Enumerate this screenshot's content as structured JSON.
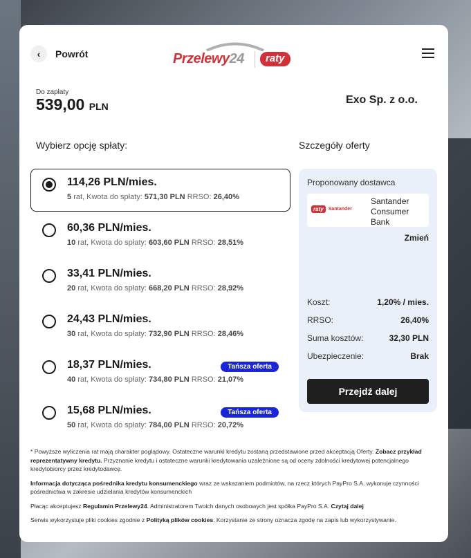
{
  "header": {
    "back_label": "Powrót",
    "logo_text": "Przelewy",
    "logo_num": "24",
    "logo_raty": "raty"
  },
  "summary": {
    "amount_label": "Do zapłaty",
    "amount_value": "539,00",
    "currency": "PLN",
    "merchant": "Exo Sp. z o.o."
  },
  "options_title": "Wybierz opcję spłaty:",
  "details_title": "Szczegóły oferty",
  "options": [
    {
      "main": "114,26 PLN/mies.",
      "n": "5",
      "rat": "rat, Kwota do spłaty:",
      "kwota": "571,30 PLN",
      "rrso_label": "RRSO:",
      "rrso": "26,40%",
      "badge": "",
      "selected": true
    },
    {
      "main": "60,36 PLN/mies.",
      "n": "10",
      "rat": "rat, Kwota do spłaty:",
      "kwota": "603,60 PLN",
      "rrso_label": "RRSO:",
      "rrso": "28,51%",
      "badge": "",
      "selected": false
    },
    {
      "main": "33,41 PLN/mies.",
      "n": "20",
      "rat": "rat, Kwota do spłaty:",
      "kwota": "668,20 PLN",
      "rrso_label": "RRSO:",
      "rrso": "28,92%",
      "badge": "",
      "selected": false
    },
    {
      "main": "24,43 PLN/mies.",
      "n": "30",
      "rat": "rat, Kwota do spłaty:",
      "kwota": "732,90 PLN",
      "rrso_label": "RRSO:",
      "rrso": "28,46%",
      "badge": "",
      "selected": false
    },
    {
      "main": "18,37 PLN/mies.",
      "n": "40",
      "rat": "rat, Kwota do spłaty:",
      "kwota": "734,80 PLN",
      "rrso_label": "RRSO:",
      "rrso": "21,07%",
      "badge": "Tańsza oferta",
      "selected": false
    },
    {
      "main": "15,68 PLN/mies.",
      "n": "50",
      "rat": "rat, Kwota do spłaty:",
      "kwota": "784,00 PLN",
      "rrso_label": "RRSO:",
      "rrso": "20,72%",
      "badge": "Tańsza oferta",
      "selected": false
    }
  ],
  "details": {
    "provider_label": "Proponowany dostawca",
    "provider_logo_raty": "raty",
    "provider_logo_bank": "Santander",
    "provider_name": "Santander Consumer Bank",
    "change_label": "Zmień",
    "rows": [
      {
        "label": "Koszt:",
        "value": "1,20% / mies."
      },
      {
        "label": "RRSO:",
        "value": "26,40%"
      },
      {
        "label": "Suma kosztów:",
        "value": "32,30 PLN"
      },
      {
        "label": "Ubezpieczenie:",
        "value": "Brak"
      }
    ],
    "next_label": "Przejdź dalej"
  },
  "footer": {
    "p1_a": "* Powyższe wyliczenia rat mają charakter poglądowy. Ostateczne warunki kredytu zostaną przedstawione przed akceptacją Oferty.",
    "p1_link": "Zobacz przykład reprezentatywny kredytu.",
    "p1_b": "Przyznanie kredytu i ostateczne warunki kredytowania uzależnione są od oceny zdolności kredytowej potencjalnego kredytobiorcy przez kredytodawcę.",
    "p2_link": "Informacja dotycząca pośrednika kredytu konsumenckiego",
    "p2_b": "wraz ze wskazaniem podmiotów, na rzecz których PayPro S.A. wykonuje czynności pośrednictwa w zakresie udzielania kredytów konsumenckich",
    "p3_a": "Płacąc akceptujesz",
    "p3_link1": "Regulamin Przelewy24",
    "p3_b": ". Administratorem Twoich danych osobowych jest spółka PayPro S.A.",
    "p3_link2": "Czytaj dalej",
    "p4_a": "Serwis wykorzystuje pliki cookies zgodnie z",
    "p4_link": "Polityką plików cookies",
    "p4_b": ". Korzystanie ze strony oznacza zgodę na zapis lub wykorzystywanie."
  }
}
